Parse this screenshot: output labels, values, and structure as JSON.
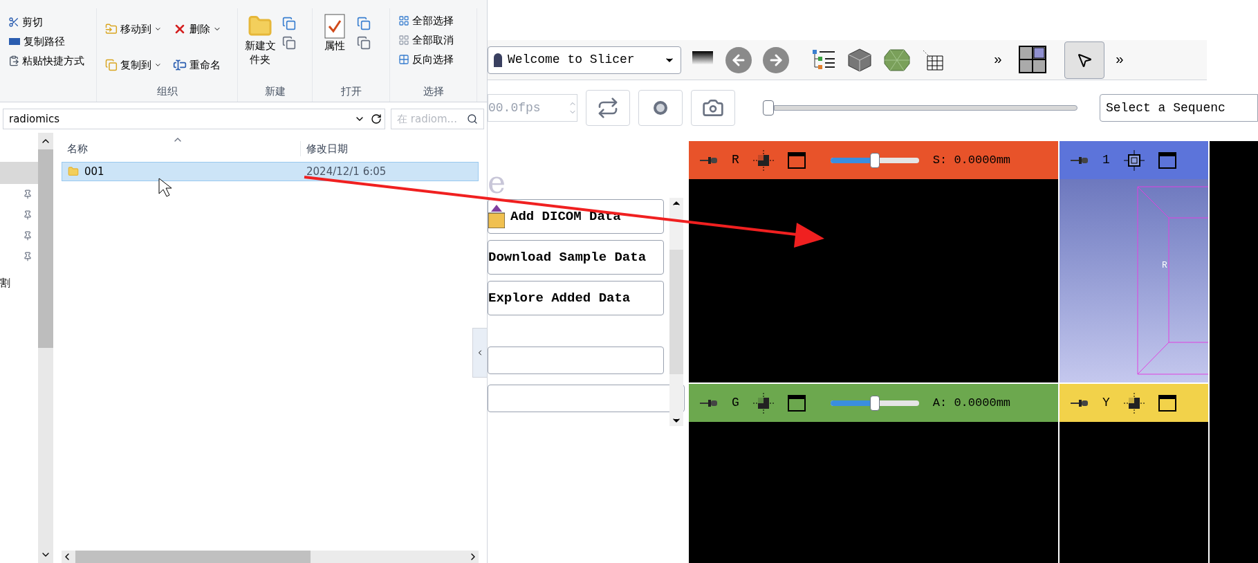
{
  "explorer": {
    "clipboard": [
      "剪切",
      "复制路径",
      "粘贴快捷方式"
    ],
    "groups": [
      {
        "label": "组织",
        "items": [
          {
            "kind": "move",
            "text": "移动到"
          },
          {
            "kind": "delete",
            "text": "删除"
          },
          {
            "kind": "copy",
            "text": "复制到"
          },
          {
            "kind": "rename",
            "text": "重命名"
          }
        ]
      },
      {
        "label": "新建",
        "big": "新建文件夹"
      },
      {
        "label": "打开",
        "big": "属性"
      },
      {
        "label": "选择",
        "items": [
          {
            "kind": "select-all",
            "text": "全部选择"
          },
          {
            "kind": "select-none",
            "text": "全部取消"
          },
          {
            "kind": "invert",
            "text": "反向选择"
          }
        ]
      }
    ],
    "address": "radiomics",
    "search_placeholder": "在 radiom...",
    "nav_text": "割",
    "columns": [
      "名称",
      "修改日期"
    ],
    "rows": [
      {
        "name": "001",
        "date": "2024/12/1 6:05",
        "selected": true
      }
    ]
  },
  "slicer": {
    "module": "Welcome to Slicer",
    "toolbar_more": [
      "»",
      "»"
    ],
    "fps": "00.0fps",
    "sequence_placeholder": "Select a Sequenc",
    "heading_fragment": "e",
    "buttons": [
      "Add DICOM Data",
      "Download Sample Data",
      "Explore Added Data"
    ],
    "views": [
      {
        "kind": "slice",
        "letter": "R",
        "color": "#e8532a",
        "offset": "S: 0.0000mm",
        "level": 0.5
      },
      {
        "kind": "volume",
        "letter": "1",
        "color": "#5c74da",
        "orientation": "R"
      },
      {
        "kind": "slice",
        "letter": "G",
        "color": "#6ca84e",
        "offset": "A: 0.0000mm",
        "level": 0.5
      },
      {
        "kind": "slice",
        "letter": "Y",
        "color": "#f2d24a"
      }
    ]
  }
}
